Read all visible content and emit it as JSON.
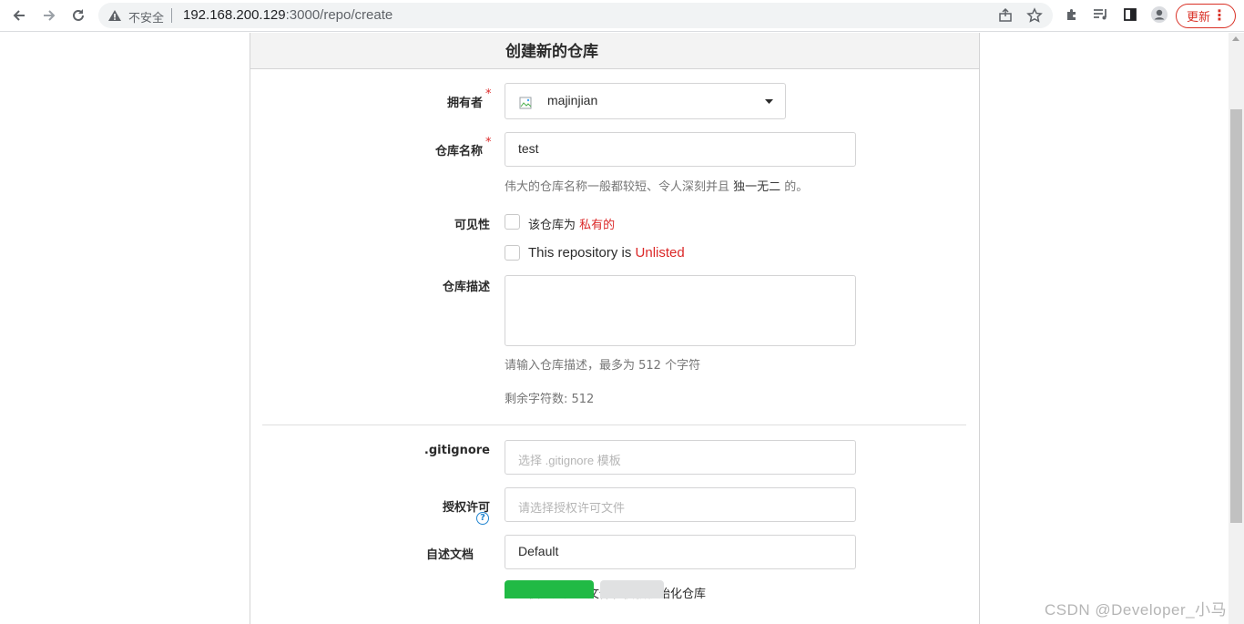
{
  "browser": {
    "insecure_label": "不安全",
    "url_host": "192.168.200.129",
    "url_path": ":3000/repo/create",
    "update_label": "更新"
  },
  "form": {
    "title": "创建新的仓库",
    "owner": {
      "label": "拥有者",
      "required_mark": "*",
      "value": "majinjian"
    },
    "repo_name": {
      "label": "仓库名称",
      "required_mark": "*",
      "value": "test"
    },
    "repo_name_help": {
      "prefix": "伟大的仓库名称一般都较短、令人深刻并且 ",
      "emphasis": "独一无二",
      "suffix": " 的。"
    },
    "visibility": {
      "label": "可见性",
      "private_prefix": "该仓库为 ",
      "private_emphasis": "私有的",
      "unlisted_prefix": "This repository is ",
      "unlisted_emphasis": "Unlisted"
    },
    "description": {
      "label": "仓库描述",
      "value": "",
      "help": "请输入仓库描述，最多为 512 个字符",
      "remaining": "剩余字符数: 512"
    },
    "gitignore": {
      "label": ".gitignore",
      "placeholder": "选择 .gitignore 模板"
    },
    "license": {
      "label": "授权许可",
      "placeholder": "请选择授权许可文件"
    },
    "readme": {
      "label": "自述文档",
      "help_glyph": "?",
      "value": "Default"
    },
    "auto_init_label": "使用选定的文件和模板初始化仓库"
  },
  "watermark": "CSDN @Developer_小马"
}
